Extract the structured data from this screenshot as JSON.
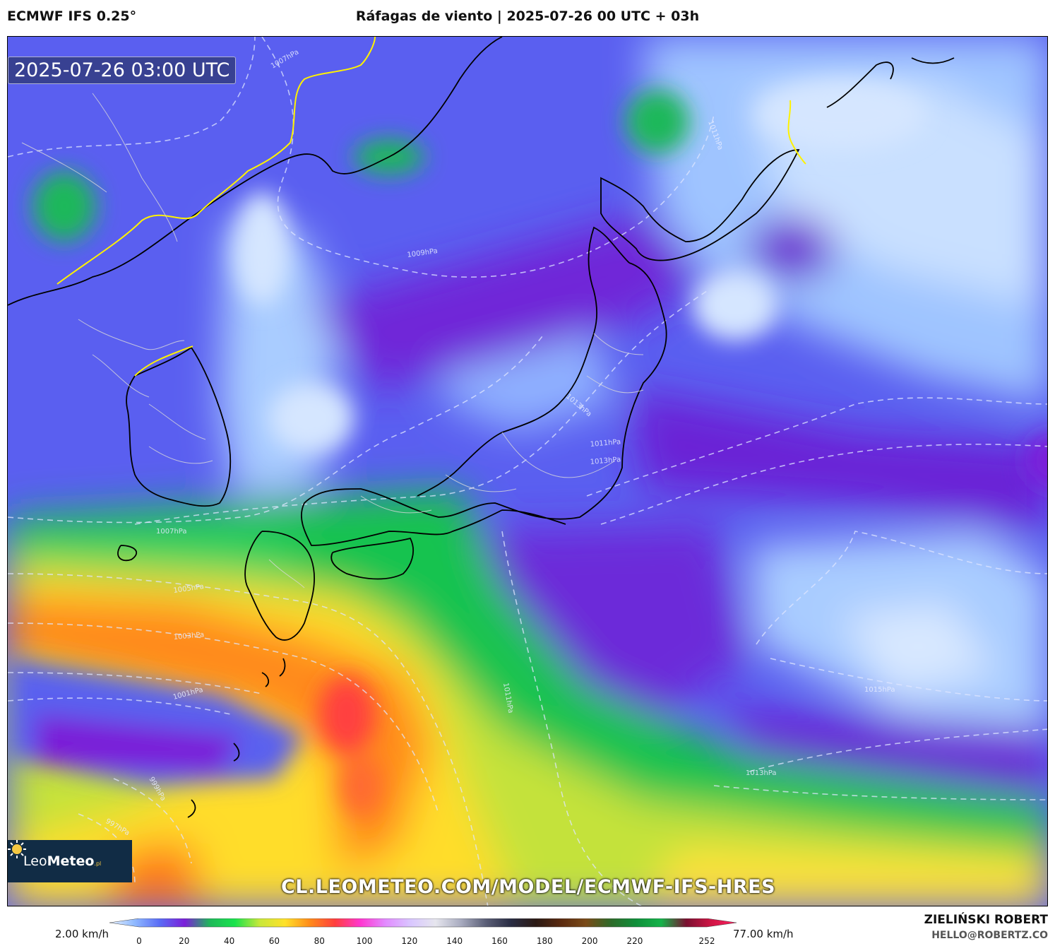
{
  "header": {
    "model": "ECMWF IFS 0.25°",
    "title": "Ráfagas de viento | 2025-07-26 00 UTC + 03h"
  },
  "map": {
    "valid_time": "2025-07-26 03:00 UTC",
    "isobar_labels": [
      "1007hPa",
      "1011hPa",
      "1009hPa",
      "1013hPa",
      "1011hPa",
      "1007hPa",
      "1005hPa",
      "1003hPa",
      "1001hPa",
      "999hPa",
      "997hPa",
      "1011hPa",
      "1015hPa",
      "1013hPa",
      "1013hPa"
    ],
    "watermark_url": "CL.LEOMETEO.COM/MODEL/ECMWF-IFS-HRES"
  },
  "logo": {
    "brand_light": "Leo",
    "brand_bold": "Meteo",
    "brand_suffix": ".pl"
  },
  "legend": {
    "min_label": "2.00 km/h",
    "max_label": "77.00 km/h",
    "ticks": [
      "0",
      "20",
      "40",
      "60",
      "80",
      "100",
      "120",
      "140",
      "160",
      "180",
      "200",
      "220",
      "252"
    ],
    "tick_values": [
      0,
      20,
      40,
      60,
      80,
      100,
      120,
      140,
      160,
      180,
      200,
      220,
      252
    ],
    "colors": [
      "#e9f3ff",
      "#8fb9ff",
      "#5a6cf5",
      "#7c1fd9",
      "#1fb85a",
      "#19e34d",
      "#c9e83a",
      "#ffe12a",
      "#ff8a1a",
      "#ff3e3e",
      "#ff36d0",
      "#e28bff",
      "#d9c6ff",
      "#e6e6ee",
      "#a9acc0",
      "#5b5f77",
      "#2a2d44",
      "#2b1a14",
      "#5a2a10",
      "#7a4a18",
      "#2e6b2a",
      "#0f8f3a",
      "#15b34a",
      "#7a1030",
      "#d01545",
      "#ff2060"
    ]
  },
  "footer": {
    "author": "ZIELIŃSKI ROBERT",
    "contact": "HELLO@ROBERTZ.CO"
  }
}
